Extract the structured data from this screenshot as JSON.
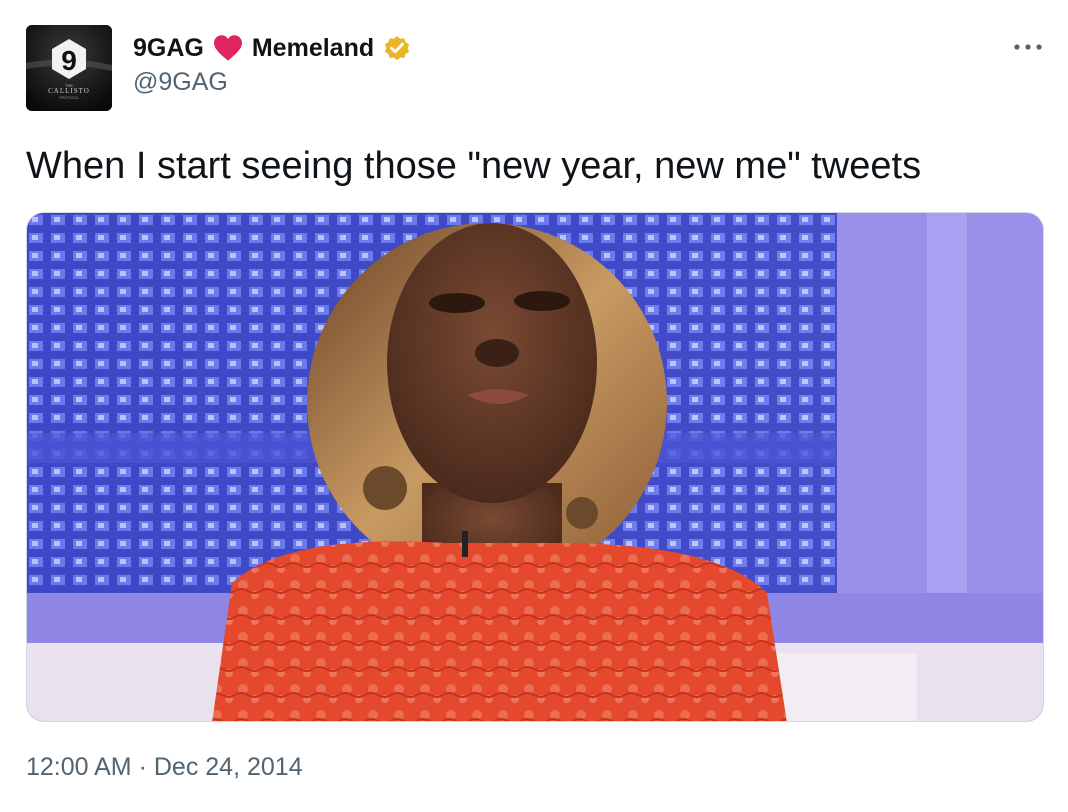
{
  "tweet": {
    "account": {
      "display_name": "9GAG",
      "second_name": "Memeland",
      "handle": "@9GAG",
      "avatar": {
        "logo_glyph": "9",
        "caption_line1": "THE",
        "caption_line2": "CALLISTO",
        "caption_line3": "PROTOCOL"
      },
      "heart_icon": "heart-icon",
      "verified_icon": "gold-verified-badge-icon",
      "verified_color": "#e8b627",
      "heart_color": "#e0245e"
    },
    "more_icon": "more-dots-icon",
    "text": "When I start seeing those \"new year, new me\" tweets",
    "media": {
      "type": "photo",
      "description_icon": "meme-photo"
    },
    "time": "12:00 AM",
    "separator": "·",
    "date": "Dec 24, 2014"
  },
  "colors": {
    "text_primary": "#0f1419",
    "text_secondary": "#536471",
    "border": "#cfd9de"
  }
}
